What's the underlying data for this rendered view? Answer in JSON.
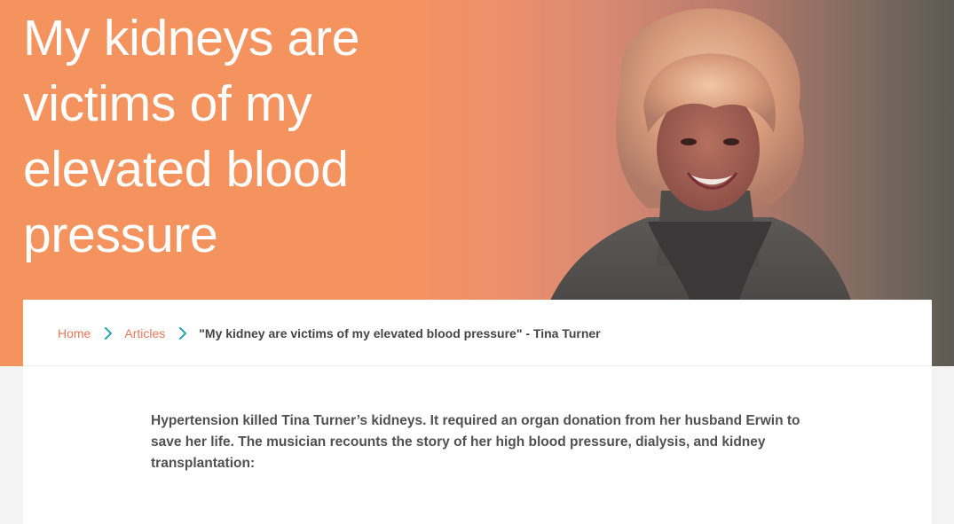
{
  "hero": {
    "title": "My kidneys are victims of my elevated blood pressure",
    "image": "tina-turner-portrait"
  },
  "breadcrumb": {
    "home_label": "Home",
    "articles_label": "Articles",
    "current_label": "\"My kidney are victims of my elevated blood pressure\" - Tina Turner",
    "separator_icon": "chevron-right-icon"
  },
  "article": {
    "intro": "Hypertension killed Tina Turner’s kidneys. It required an organ donation from her husband Erwin to save her life. The musician recounts the story of her high blood pressure, dialysis, and kidney transplantation:"
  },
  "colors": {
    "hero_bg": "#f5935f",
    "link": "#e8775a",
    "chevron": "#2aa3b0",
    "body_text": "#505050"
  }
}
